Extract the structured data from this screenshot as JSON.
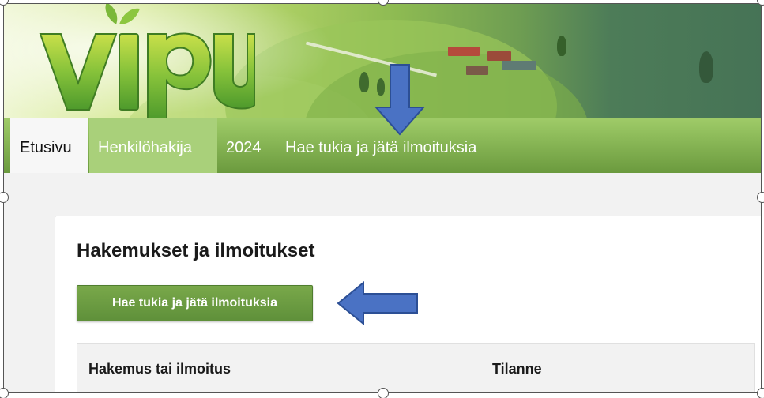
{
  "logo": {
    "text": "vipu",
    "alt": "Vipu logo"
  },
  "nav": {
    "items": [
      {
        "label": "Etusivu",
        "state": "active"
      },
      {
        "label": "Henkilöhakija",
        "state": "highlighted"
      },
      {
        "label": "2024",
        "state": "normal"
      },
      {
        "label": "Hae tukia ja jätä ilmoituksia",
        "state": "normal"
      }
    ]
  },
  "main": {
    "title": "Hakemukset ja ilmoitukset",
    "primary_button": "Hae tukia ja jätä ilmoituksia",
    "table": {
      "columns": [
        "Hakemus tai ilmoitus",
        "Tilanne"
      ]
    }
  },
  "colors": {
    "brand_green": "#6b9a3e",
    "button_green": "#5f903a",
    "annotation_arrow": "#4a72c4"
  },
  "annotations": [
    "arrow-down-pointing-to-nav-item",
    "arrow-left-pointing-to-button"
  ]
}
